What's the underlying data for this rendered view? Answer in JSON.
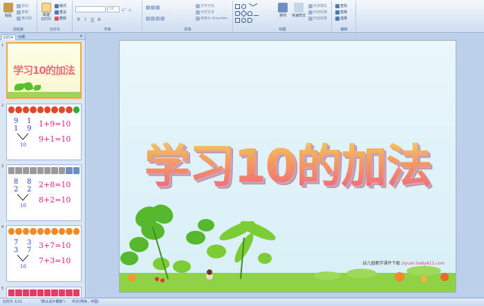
{
  "ribbon": {
    "clipboard": {
      "paste": "粘贴",
      "cut": "剪切",
      "copy": "复制",
      "format_painter": "格式刷",
      "group_label": "剪贴板"
    },
    "slides": {
      "new_slide": "新建\n幻灯片",
      "layout": "版式",
      "reset": "重设",
      "delete": "删除",
      "group_label": "幻灯片"
    },
    "font": {
      "font_name": "",
      "font_size": "18",
      "group_label": "字体",
      "bold": "B",
      "italic": "I",
      "underline": "U",
      "strike": "S"
    },
    "paragraph": {
      "text_direction": "文字方向",
      "align_text": "对齐文本",
      "convert_smartart": "转换为 SmartArt",
      "group_label": "段落"
    },
    "drawing": {
      "arrange": "排列",
      "quick_styles": "快速样式",
      "shape_fill": "形状填充",
      "shape_outline": "形状轮廓",
      "shape_effects": "形状效果",
      "group_label": "绘图"
    },
    "editing": {
      "find": "查找",
      "replace": "替换",
      "select": "选择",
      "group_label": "编辑"
    }
  },
  "panel": {
    "tab_slides": "幻灯片",
    "tab_outline": "大纲",
    "close": "×",
    "thumbnails": [
      {
        "num": "1",
        "title": "学习10的加法"
      },
      {
        "num": "2",
        "top": "9",
        "bottom": "1",
        "ten": "10",
        "eq1": "1+9=10",
        "eq2": "9+1=10"
      },
      {
        "num": "3",
        "top": "8",
        "bottom": "2",
        "ten": "10",
        "eq1": "2+8=10",
        "eq2": "8+2=10"
      },
      {
        "num": "4",
        "top": "7",
        "bottom": "3",
        "ten": "10",
        "eq1": "3+7=10",
        "eq2": "7+3=10"
      },
      {
        "num": "5"
      }
    ]
  },
  "slide": {
    "title": "学习10的加法",
    "credit_text": "幼儿园教学课件下载",
    "credit_url": "ziyuan.baby611.com"
  },
  "status": {
    "slide_info": "幻灯片 1/11",
    "theme": "\"默认设计模板\"",
    "language": "中文(简体，中国)"
  },
  "colors": {
    "title_gradient_top": "#f7df62",
    "title_gradient_bottom": "#f25d84",
    "equation": "#e8208a",
    "number": "#1f3fd0"
  }
}
